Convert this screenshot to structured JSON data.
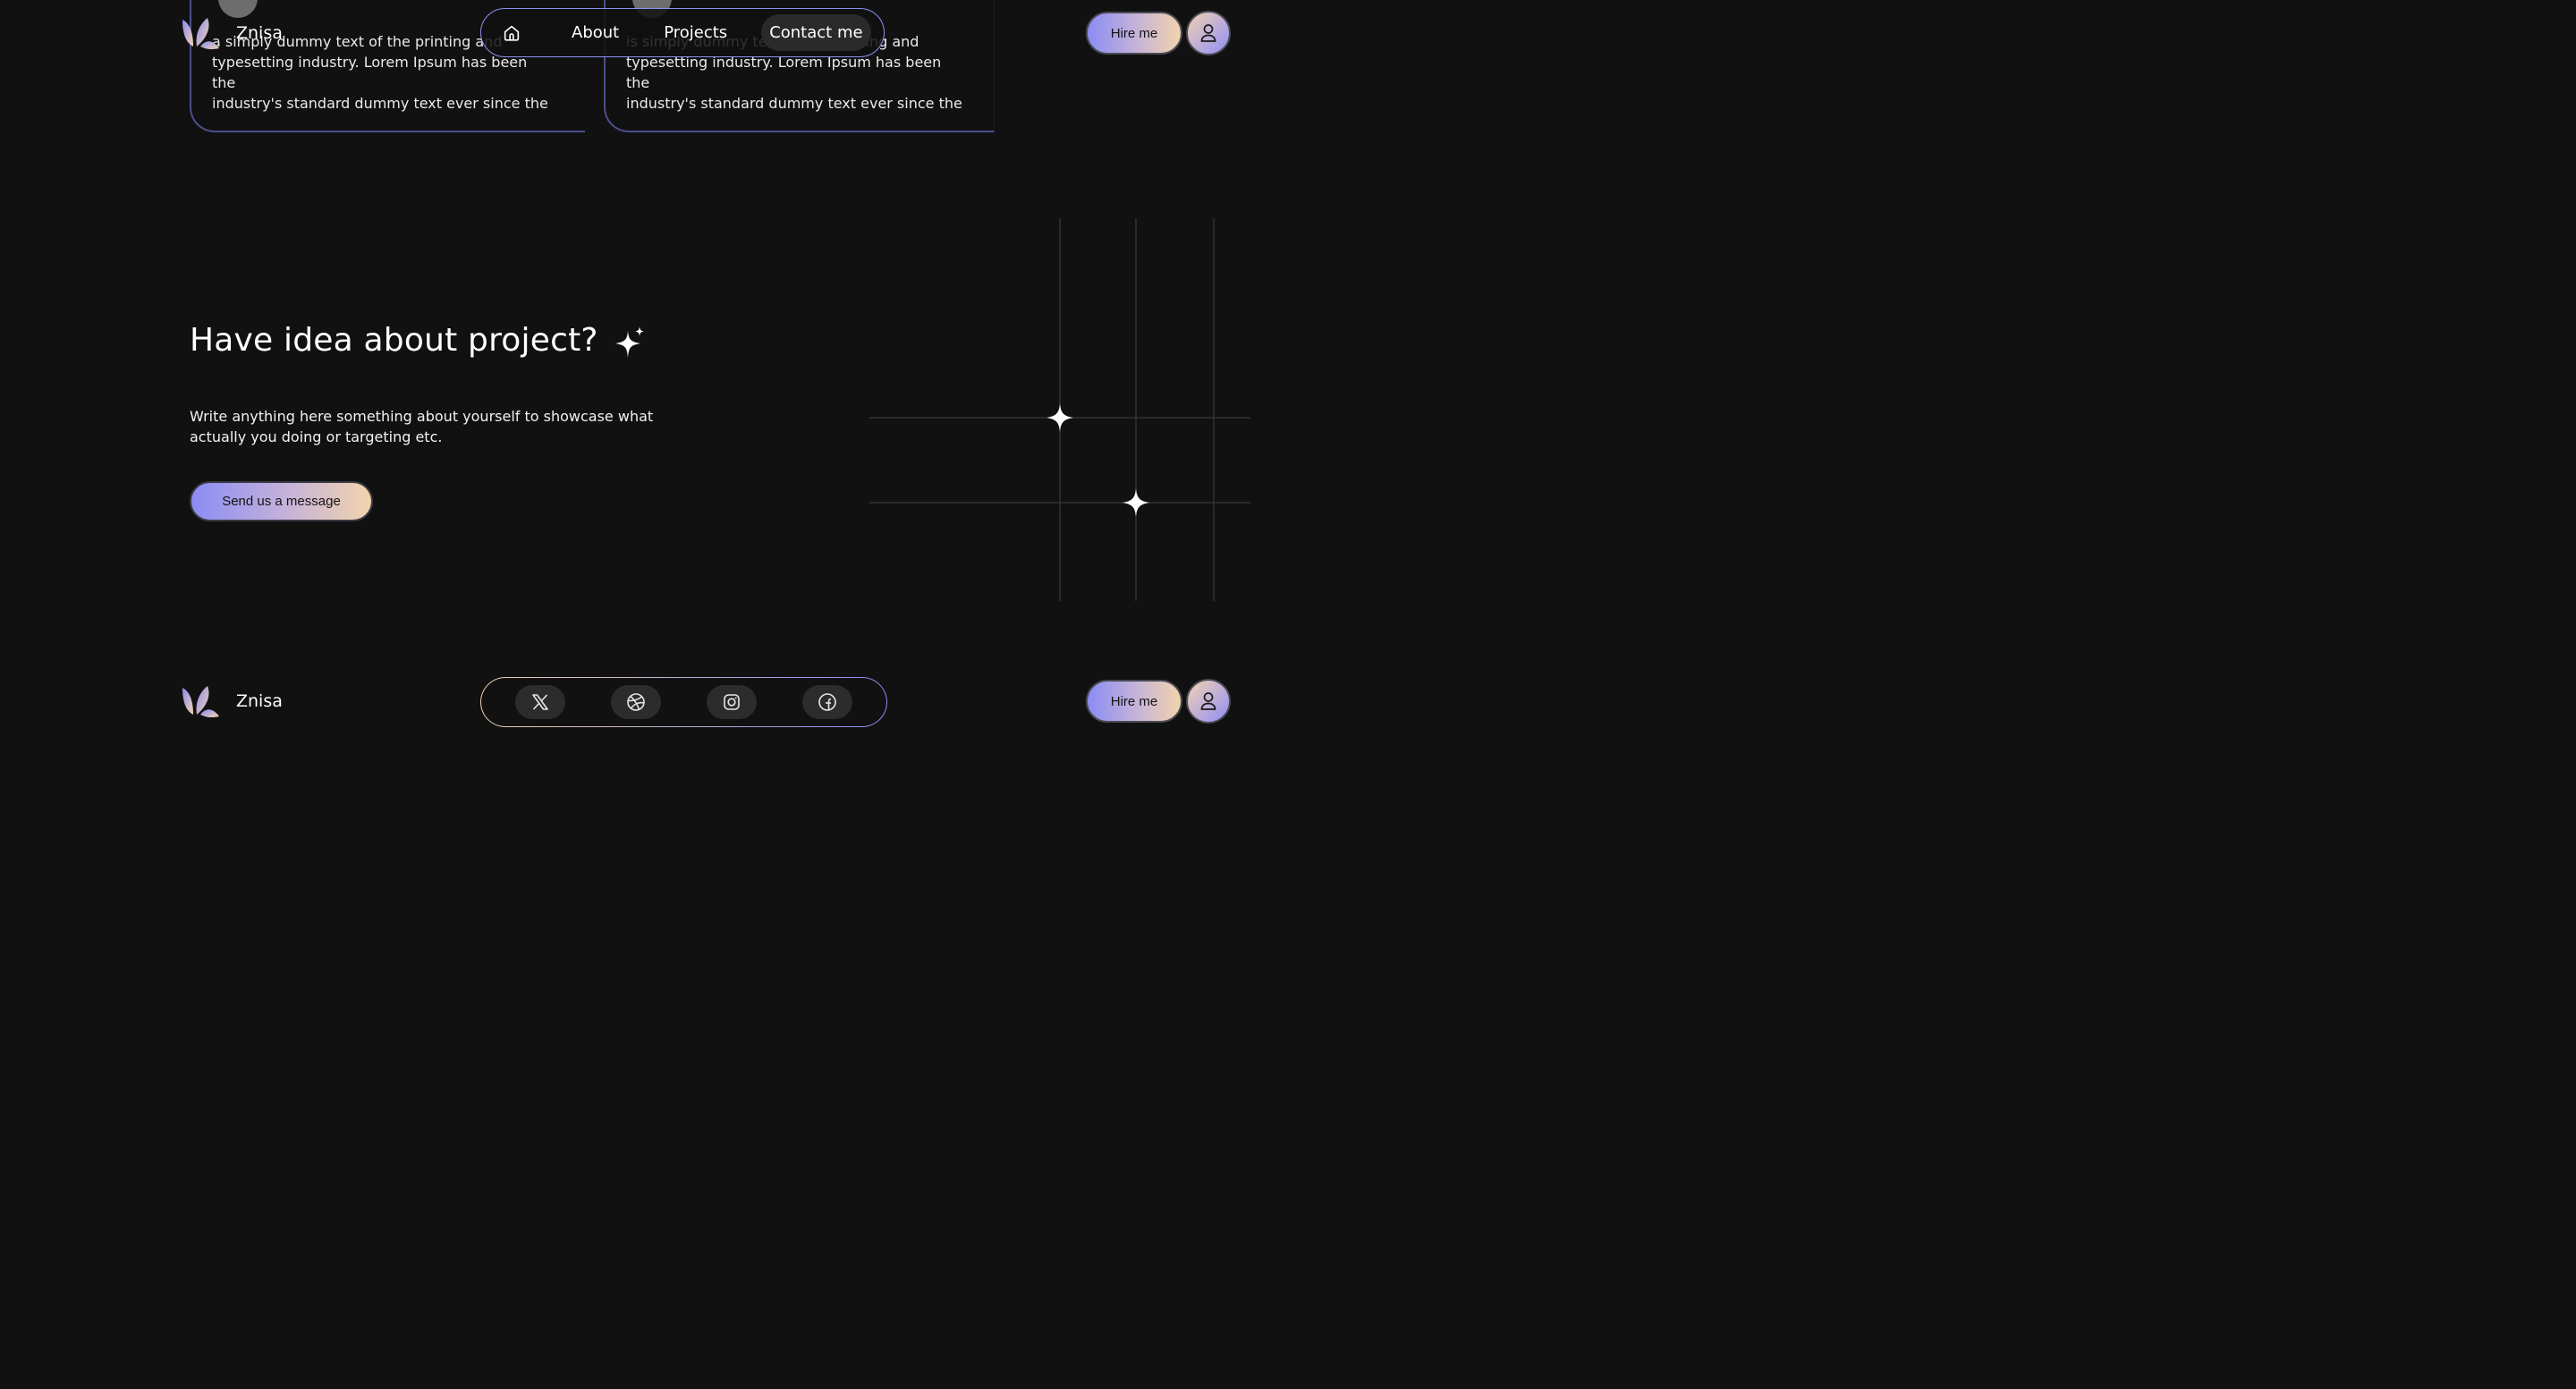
{
  "brand": {
    "name": "Znisa"
  },
  "nav": {
    "items": [
      {
        "label": "About"
      },
      {
        "label": "Projects"
      },
      {
        "label": "Contact me",
        "active": true
      }
    ]
  },
  "header_actions": {
    "hire_label": "Hire me"
  },
  "cards": [
    {
      "lines": [
        "a simply dummy text of the printing and",
        "typesetting industry. Lorem Ipsum has been the",
        "industry's standard dummy text ever since the"
      ]
    },
    {
      "lines": [
        "is simply dummy text of the printing and",
        "typesetting industry. Lorem Ipsum has been the",
        "industry's standard dummy text ever since the"
      ]
    }
  ],
  "cta": {
    "title": "Have idea about project?",
    "description": "Write anything here something about yourself to showcase what actually you doing or targeting etc.",
    "button_label": "Send us a message"
  },
  "footer": {
    "brand_name": "Znisa",
    "hire_label": "Hire me",
    "social": [
      "x-icon",
      "dribbble-icon",
      "instagram-icon",
      "facebook-icon"
    ]
  },
  "colors": {
    "background": "#111111",
    "accent_purple": "#8b8cf5",
    "accent_peach": "#f2d3ad"
  }
}
